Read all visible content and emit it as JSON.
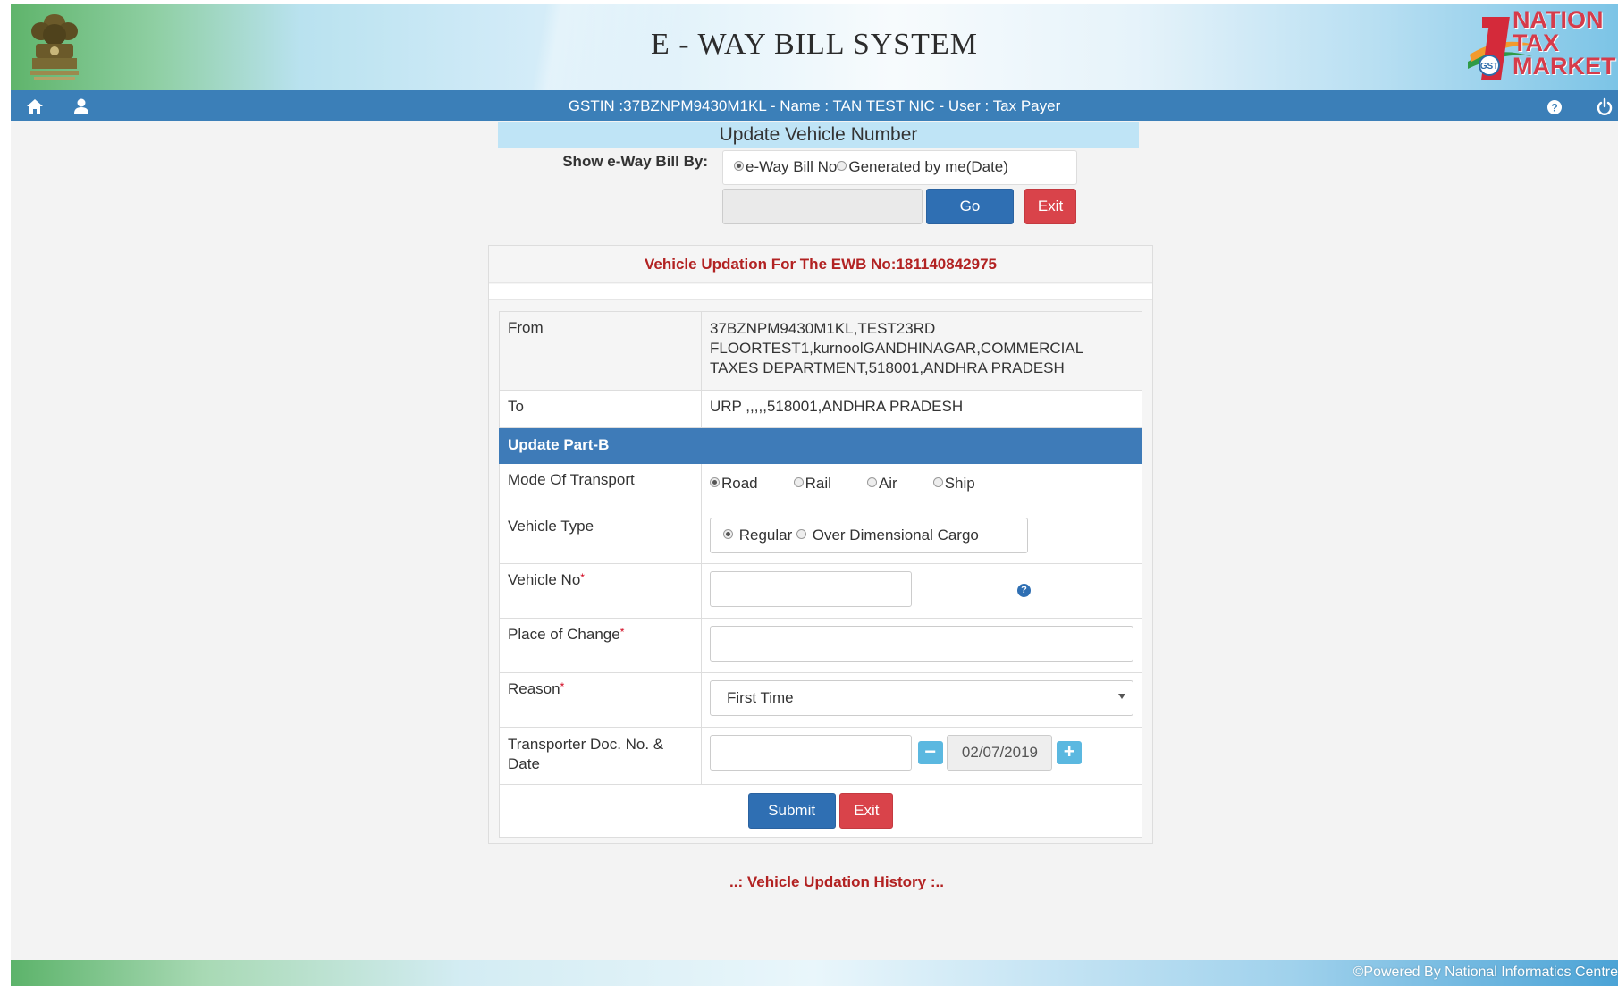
{
  "header": {
    "title": "E - WAY BILL SYSTEM",
    "brand": [
      "NATION",
      "TAX",
      "MARKET"
    ],
    "brand_badge": "GST"
  },
  "navbar": {
    "user_info": "GSTIN :37BZNPM9430M1KL - Name : TAN TEST NIC - User : Tax Payer",
    "icons": [
      "home-icon",
      "user-icon",
      "help-icon",
      "power-icon"
    ]
  },
  "search": {
    "panel_title": "Update Vehicle Number",
    "show_label": "Show e-Way Bill By:",
    "options": [
      "e-Way Bill No",
      "Generated by me(Date)"
    ],
    "selected": "e-Way Bill No",
    "ewb_value": "",
    "go_label": "Go",
    "exit_label": "Exit"
  },
  "card": {
    "heading": "Vehicle Updation For The EWB No:181140842975",
    "from_label": "From",
    "from_lines": [
      "37BZNPM9430M1KL,TEST23RD",
      "FLOORTEST1,kurnoolGANDHINAGAR,COMMERCIAL",
      "TAXES DEPARTMENT,518001,ANDHRA PRADESH"
    ],
    "to_label": "To",
    "to_value": "URP ,,,,,518001,ANDHRA PRADESH",
    "section_title": "Update Part-B",
    "mode_label": "Mode Of Transport",
    "modes": [
      "Road",
      "Rail",
      "Air",
      "Ship"
    ],
    "mode_selected": "Road",
    "vehicle_type_label": "Vehicle Type",
    "vehicle_types": [
      "Regular",
      "Over Dimensional Cargo"
    ],
    "vehicle_type_selected": "Regular",
    "vehicle_no_label": "Vehicle No",
    "vehicle_no_value": "",
    "place_label": "Place of Change",
    "place_value": "",
    "reason_label": "Reason",
    "reason_value": "First Time",
    "transporter_label_1": "Transporter Doc. No. &",
    "transporter_label_2": "Date",
    "transporter_doc_value": "",
    "transporter_date": "02/07/2019",
    "required_mark": "*",
    "minus": "−",
    "plus": "+",
    "help_mark": "?",
    "submit_label": "Submit",
    "exit_label": "Exit"
  },
  "history_link": "..: Vehicle Updation History :..",
  "footer": {
    "text": "©Powered By National Informatics Centre"
  },
  "colors": {
    "navbar": "#3b7fb8",
    "section_header": "#3e7bb8",
    "primary_button": "#2f6fb3",
    "danger_button": "#d9434a",
    "heading_red": "#b22222",
    "panel_title_bg": "#bfe4f6"
  }
}
